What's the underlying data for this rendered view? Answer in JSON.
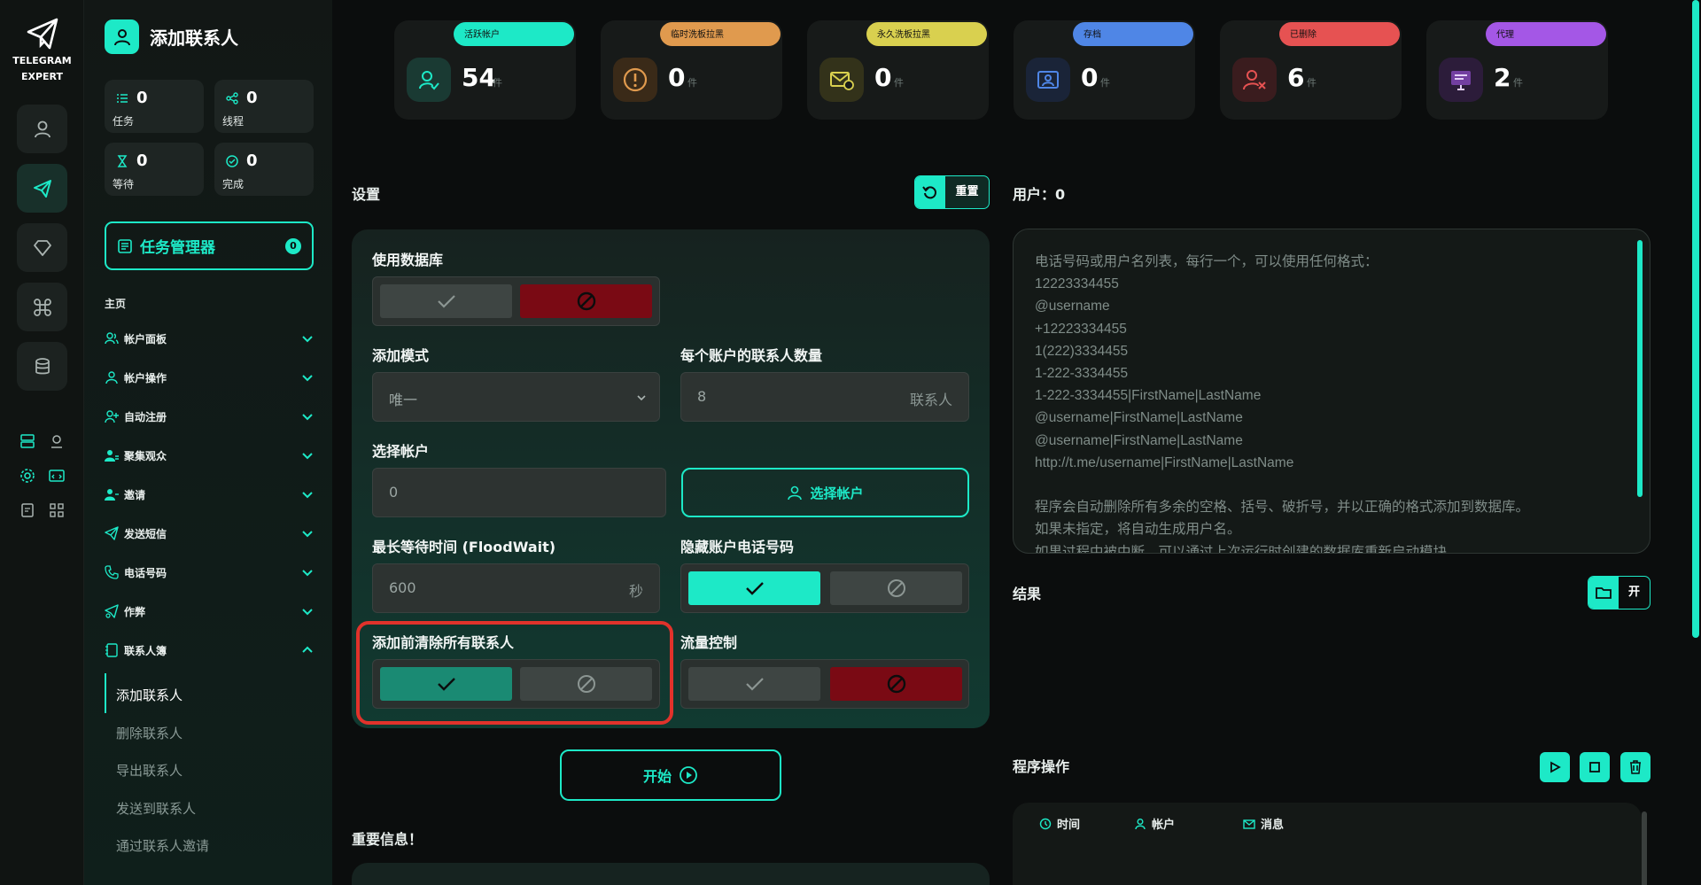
{
  "brand": {
    "line1": "TELEGRAM",
    "line2": "EXPERT"
  },
  "sidebar": {
    "title": "添加联系人",
    "stats": [
      {
        "value": "0",
        "label": "任务"
      },
      {
        "value": "0",
        "label": "线程"
      },
      {
        "value": "0",
        "label": "等待"
      },
      {
        "value": "0",
        "label": "完成"
      }
    ],
    "task_manager": {
      "label": "任务管理器",
      "badge": "0"
    },
    "section": "主页",
    "nav": [
      {
        "label": "帐户面板"
      },
      {
        "label": "帐户操作"
      },
      {
        "label": "自动注册"
      },
      {
        "label": "聚集观众"
      },
      {
        "label": "邀请"
      },
      {
        "label": "发送短信"
      },
      {
        "label": "电话号码"
      },
      {
        "label": "作弊"
      },
      {
        "label": "联系人簿"
      }
    ],
    "sub_nav": [
      {
        "label": "添加联系人"
      },
      {
        "label": "删除联系人"
      },
      {
        "label": "导出联系人"
      },
      {
        "label": "发送到联系人"
      },
      {
        "label": "通过联系人邀请"
      }
    ]
  },
  "top_cards": [
    {
      "pill": "活跃帐户",
      "value": "54",
      "unit": "件",
      "color": "#1de9c7"
    },
    {
      "pill": "临时洗板拉黑",
      "value": "0",
      "unit": "件",
      "color": "#e09a4e"
    },
    {
      "pill": "永久洗板拉黑",
      "value": "0",
      "unit": "件",
      "color": "#d9d04f"
    },
    {
      "pill": "存档",
      "value": "0",
      "unit": "件",
      "color": "#4f86e6"
    },
    {
      "pill": "已删除",
      "value": "6",
      "unit": "件",
      "color": "#e65252"
    },
    {
      "pill": "代理",
      "value": "2",
      "unit": "件",
      "color": "#a457e6"
    }
  ],
  "settings": {
    "title": "设置",
    "reset_label": "重置",
    "use_db_label": "使用数据库",
    "add_mode_label": "添加模式",
    "add_mode_value": "唯一",
    "contacts_per_account_label": "每个账户的联系人数量",
    "contacts_per_account_value": "8",
    "contacts_unit": "联系人",
    "select_accounts_label": "选择帐户",
    "select_accounts_value": "0",
    "select_accounts_button": "选择帐户",
    "floodwait_label": "最长等待时间 (FloodWait)",
    "floodwait_value": "600",
    "floodwait_unit": "秒",
    "hide_phone_label": "隐藏账户电话号码",
    "clear_before_label": "添加前清除所有联系人",
    "traffic_label": "流量控制",
    "start_label": "开始",
    "important_label": "重要信息！"
  },
  "users": {
    "title": "用户：0",
    "placeholder": "电话号码或用户名列表，每行一个，可以使用任何格式：\n12223334455\n@username\n+12223334455\n1(222)3334455\n1-222-3334455\n1-222-3334455|FirstName|LastName\n@username|FirstName|LastName\n@username|FirstName|LastName\nhttp://t.me/username|FirstName|LastName\n\n程序会自动删除所有多余的空格、括号、破折号，并以正确的格式添加到数据库。\n如果未指定，将自动生成用户名。\n如果过程中被中断，可以通过上次运行时创建的数据库重新启动模块。"
  },
  "results": {
    "title": "结果",
    "open_label": "开"
  },
  "operations": {
    "title": "程序操作",
    "columns": [
      "时间",
      "帐户",
      "消息"
    ]
  },
  "colors": {
    "accent": "#1de9c7",
    "danger": "#7a0a14",
    "highlight": "#e1322b"
  }
}
